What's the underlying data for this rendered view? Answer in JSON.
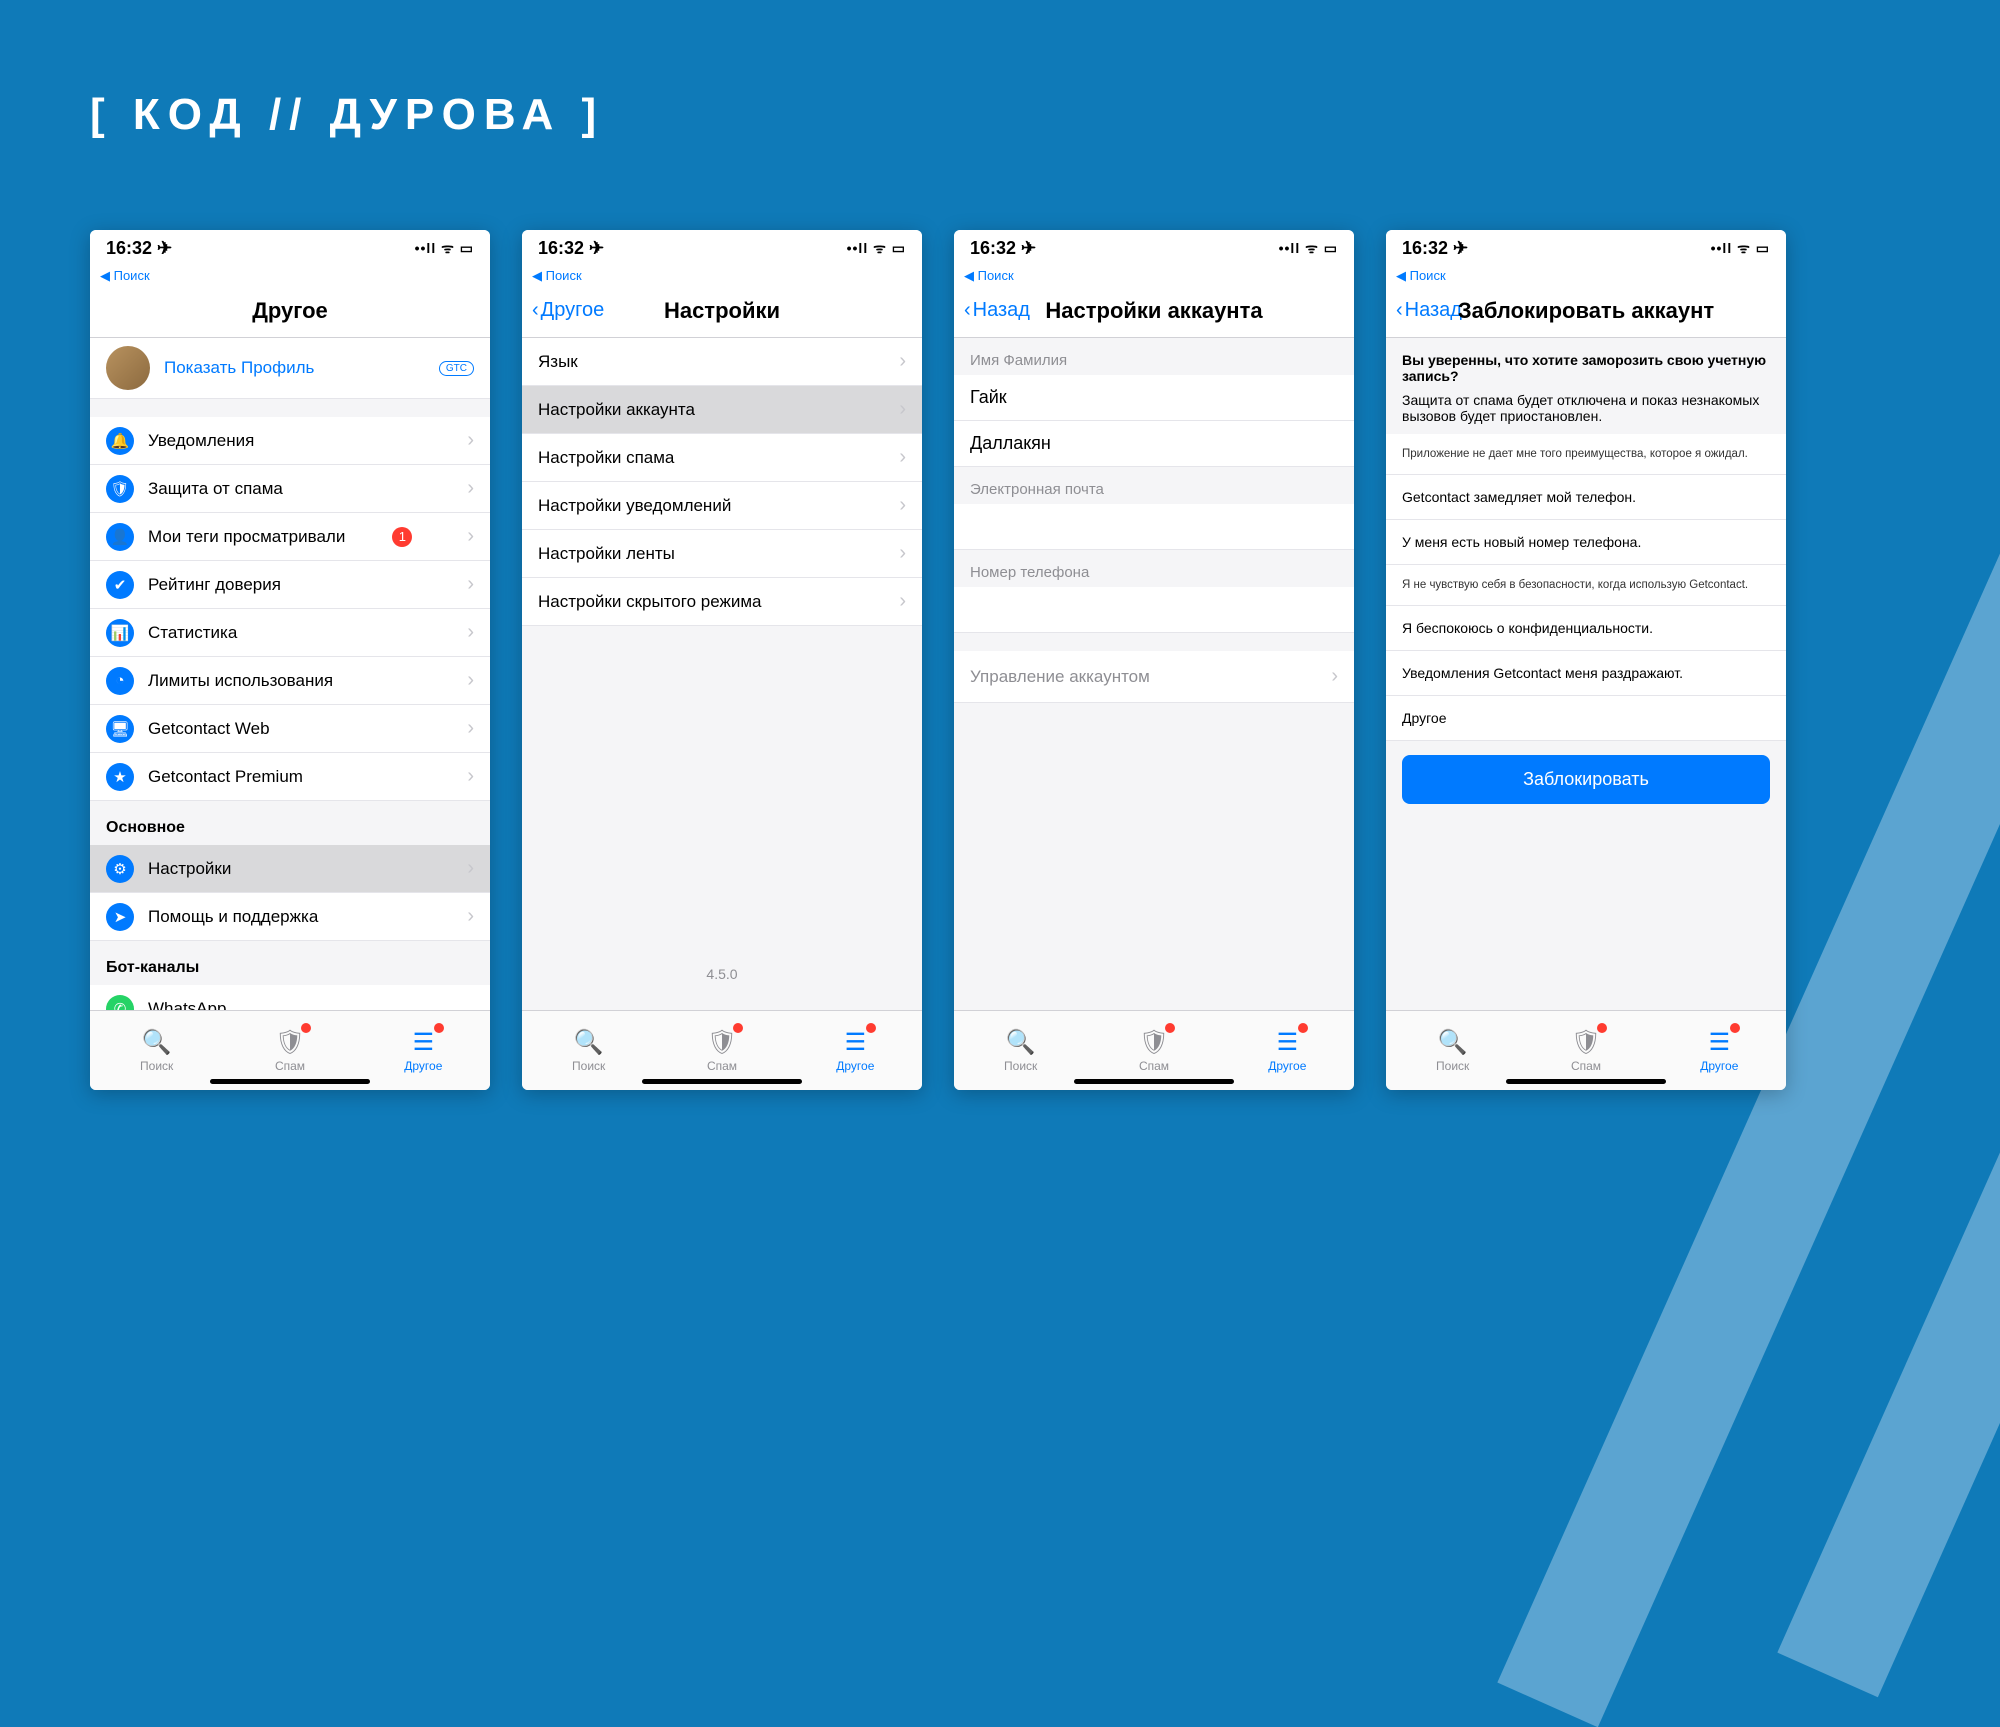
{
  "brand": "[ КОД // ДУРОВА ]",
  "status": {
    "time": "16:32",
    "icons": "📶 📡 🔋"
  },
  "tabs": {
    "search": "Поиск",
    "spam": "Спам",
    "other": "Другое"
  },
  "screen1": {
    "breadcrumb": "◀ Поиск",
    "title": "Другое",
    "profile_link": "Показать Профиль",
    "profile_pill": "GTC",
    "items": [
      {
        "label": "Уведомления"
      },
      {
        "label": "Защита от спама"
      },
      {
        "label": "Мои теги просматривали",
        "badge": "1"
      },
      {
        "label": "Рейтинг доверия"
      },
      {
        "label": "Статистика"
      },
      {
        "label": "Лимиты использования"
      },
      {
        "label": "Getcontact Web"
      },
      {
        "label": "Getcontact Premium"
      }
    ],
    "section2": "Основное",
    "items2": [
      {
        "label": "Настройки",
        "selected": true
      },
      {
        "label": "Помощь и поддержка"
      }
    ],
    "section3": "Бот-каналы",
    "items3": [
      {
        "label": "WhatsApp"
      }
    ]
  },
  "screen2": {
    "breadcrumb": "◀ Поиск",
    "back": "Другое",
    "title": "Настройки",
    "items": [
      {
        "label": "Язык"
      },
      {
        "label": "Настройки аккаунта",
        "selected": true
      },
      {
        "label": "Настройки спама"
      },
      {
        "label": "Настройки уведомлений"
      },
      {
        "label": "Настройки ленты"
      },
      {
        "label": "Настройки скрытого режима"
      }
    ],
    "version": "4.5.0"
  },
  "screen3": {
    "breadcrumb": "◀ Поиск",
    "back": "Назад",
    "title": "Настройки аккаунта",
    "name_label": "Имя Фамилия",
    "first_name": "Гайк",
    "last_name": "Даллакян",
    "email_label": "Электронная почта",
    "phone_label": "Номер телефона",
    "manage": "Управление аккаунтом"
  },
  "screen4": {
    "breadcrumb": "◀ Поиск",
    "back": "Назад",
    "title": "Заблокировать аккаунт",
    "confirm_q": "Вы уверенны, что хотите заморозить свою учетную запись?",
    "confirm_text": "Защита от спама будет отключена и показ незнакомых вызовов будет приостановлен.",
    "reasons": [
      "Приложение не дает мне того преимущества, которое я ожидал.",
      "Getcontact замедляет мой телефон.",
      "У меня есть новый номер телефона.",
      "Я не чувствую себя в безопасности, когда использую Getcontact.",
      "Я беспокоюсь о конфиденциальности.",
      "Уведомления Getcontact меня раздражают.",
      "Другое"
    ],
    "block_btn": "Заблокировать"
  }
}
